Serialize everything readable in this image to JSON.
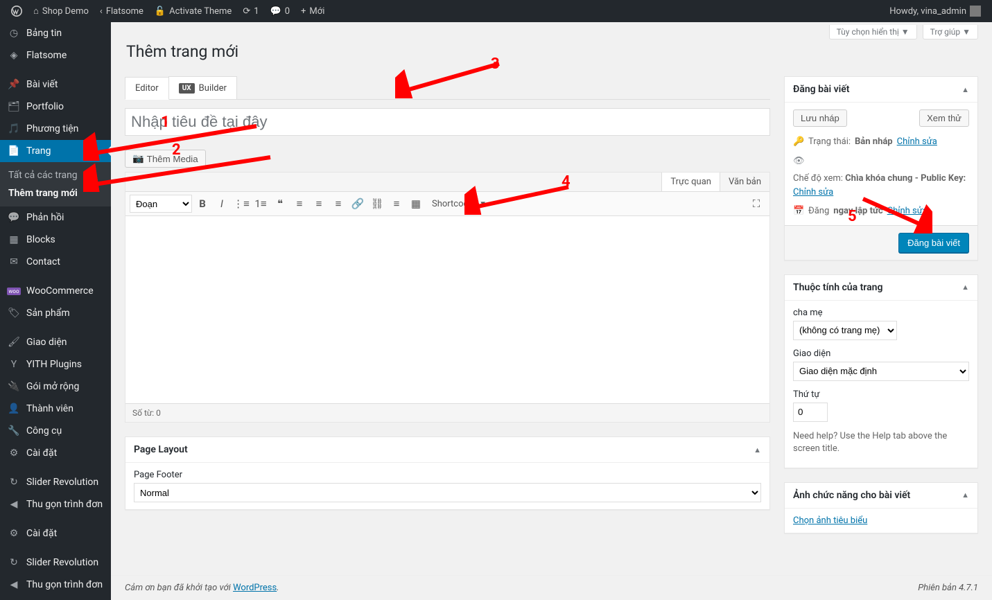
{
  "adminbar": {
    "site_name": "Shop Demo",
    "theme": "Flatsome",
    "activate": "Activate Theme",
    "updates": "1",
    "comments": "0",
    "new": "Mới",
    "howdy": "Howdy, vina_admin"
  },
  "sidebar": {
    "items": [
      {
        "label": "Bảng tin",
        "icon": "dashboard"
      },
      {
        "label": "Flatsome",
        "icon": "dropdown"
      },
      {
        "label": "Bài viết",
        "icon": "pin"
      },
      {
        "label": "Portfolio",
        "icon": "portfolio"
      },
      {
        "label": "Phương tiện",
        "icon": "media"
      },
      {
        "label": "Trang",
        "icon": "page",
        "current": true
      },
      {
        "label": "Phản hồi",
        "icon": "comment"
      },
      {
        "label": "Blocks",
        "icon": "blocks"
      },
      {
        "label": "Contact",
        "icon": "mail"
      },
      {
        "label": "WooCommerce",
        "icon": "woo"
      },
      {
        "label": "Sản phẩm",
        "icon": "product"
      },
      {
        "label": "Giao diện",
        "icon": "appearance"
      },
      {
        "label": "YITH Plugins",
        "icon": "yith"
      },
      {
        "label": "Gói mở rộng",
        "icon": "plugin"
      },
      {
        "label": "Thành viên",
        "icon": "users"
      },
      {
        "label": "Công cụ",
        "icon": "tools"
      },
      {
        "label": "Cài đặt",
        "icon": "settings"
      },
      {
        "label": "Slider Revolution",
        "icon": "slider"
      },
      {
        "label": "Thu gọn trình đơn",
        "icon": "collapse"
      },
      {
        "label": "Cài đặt",
        "icon": "settings2"
      },
      {
        "label": "Slider Revolution",
        "icon": "slider2"
      },
      {
        "label": "Thu gọn trình đơn",
        "icon": "collapse2"
      }
    ],
    "submenu": [
      {
        "label": "Tất cả các trang"
      },
      {
        "label": "Thêm trang mới",
        "current": true
      }
    ]
  },
  "screen_meta": {
    "screen_options": "Tùy chọn hiển thị",
    "help": "Trợ giúp"
  },
  "page": {
    "title": "Thêm trang mới",
    "editor_tab": "Editor",
    "builder_tab": "Builder",
    "ux_badge": "UX",
    "title_placeholder": "Nhập tiêu đề tại đây",
    "add_media": "Thêm Media",
    "visual_tab": "Trực quan",
    "text_tab": "Văn bản",
    "format_select": "Đoạn",
    "shortcodes": "Shortcodes",
    "word_count": "Số từ: 0"
  },
  "page_layout": {
    "box_title": "Page Layout",
    "footer_label": "Page Footer",
    "footer_value": "Normal"
  },
  "publish": {
    "box_title": "Đăng bài viết",
    "save_draft": "Lưu nháp",
    "preview": "Xem thử",
    "status_label": "Trạng thái:",
    "status_value": "Bản nháp",
    "edit": "Chỉnh sửa",
    "visibility_label": "Chế độ xem:",
    "visibility_value": "Chìa khóa chung - Public Key:",
    "publish_label": "Đăng",
    "publish_time": "ngay lập tức",
    "publish_btn": "Đăng bài viết"
  },
  "page_attrs": {
    "box_title": "Thuộc tính của trang",
    "parent_label": "cha mẹ",
    "parent_value": "(không có trang mẹ)",
    "template_label": "Giao diện",
    "template_value": "Giao diện mặc định",
    "order_label": "Thứ tự",
    "order_value": "0",
    "help": "Need help? Use the Help tab above the screen title."
  },
  "featured": {
    "box_title": "Ảnh chức năng cho bài viết",
    "set_link": "Chọn ảnh tiêu biểu"
  },
  "footer": {
    "thanks": "Cảm ơn bạn đã khởi tạo với ",
    "wp": "WordPress",
    "version": "Phiên bản 4.7.1"
  },
  "annotations": {
    "n1": "1",
    "n2": "2",
    "n3": "3",
    "n4": "4",
    "n5": "5"
  }
}
